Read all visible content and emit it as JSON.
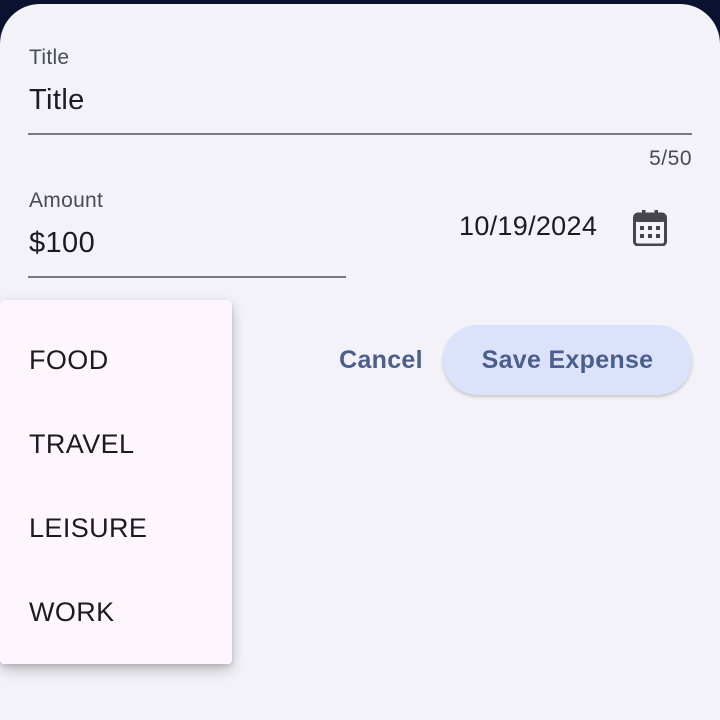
{
  "form": {
    "title_label": "Title",
    "title_value": "Title",
    "title_counter": "5/50",
    "amount_label": "Amount",
    "amount_value": "$100",
    "date_value": "10/19/2024",
    "calendar_icon": "calendar-icon"
  },
  "actions": {
    "cancel_label": "Cancel",
    "save_label": "Save Expense"
  },
  "category_menu": {
    "items": [
      {
        "label": "FOOD"
      },
      {
        "label": "TRAVEL"
      },
      {
        "label": "LEISURE"
      },
      {
        "label": "WORK"
      }
    ]
  },
  "colors": {
    "background": "#f2f2f8",
    "accent_text": "#4b5e8c",
    "save_button_bg": "#dde2fb",
    "menu_bg": "#fdf6fe"
  }
}
